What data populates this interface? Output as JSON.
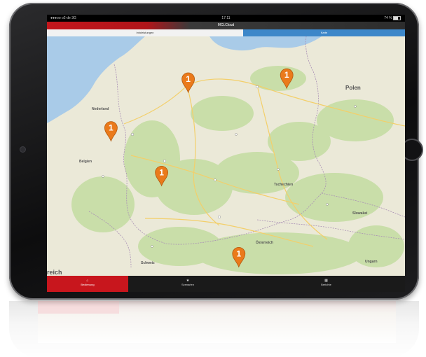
{
  "status_bar": {
    "carrier": "●●●oo o2-de  3G",
    "time": "17:11",
    "battery": "74 %"
  },
  "app": {
    "title": "MCLCloud"
  },
  "segments": [
    {
      "label": "Infoleistungen"
    },
    {
      "label": "Karte"
    }
  ],
  "map": {
    "labels": {
      "polen": "Polen",
      "niederlande": "Nederland",
      "belgien": "Belgien",
      "tschechien": "Tschechien",
      "slowakei": "Slowakei",
      "oesterreich": "Österreich",
      "schweiz": "Schweiz",
      "ungarn": "Ungarn",
      "frankreich": "reich"
    },
    "markers": [
      {
        "count": "1",
        "lon": 9.7,
        "lat": 52.4
      },
      {
        "count": "1",
        "lon": 13.4,
        "lat": 52.5
      },
      {
        "count": "1",
        "lon": 6.8,
        "lat": 51.2
      },
      {
        "count": "1",
        "lon": 8.7,
        "lat": 50.1
      },
      {
        "count": "1",
        "lon": 11.6,
        "lat": 48.1
      }
    ],
    "colors": {
      "land": "#ebe9d8",
      "forest": "#c9dea9",
      "water": "#a9cbe8",
      "marker": "#ea7a1b",
      "road": "#f3cf6a"
    }
  },
  "tabs": [
    {
      "icon": "home-icon",
      "label": "Bedienung"
    },
    {
      "icon": "star-icon",
      "label": "Szenarien"
    },
    {
      "icon": "grid-icon",
      "label": "Berichte"
    }
  ],
  "colors": {
    "accent": "#c8161d",
    "segment_active": "#3d87c9"
  }
}
